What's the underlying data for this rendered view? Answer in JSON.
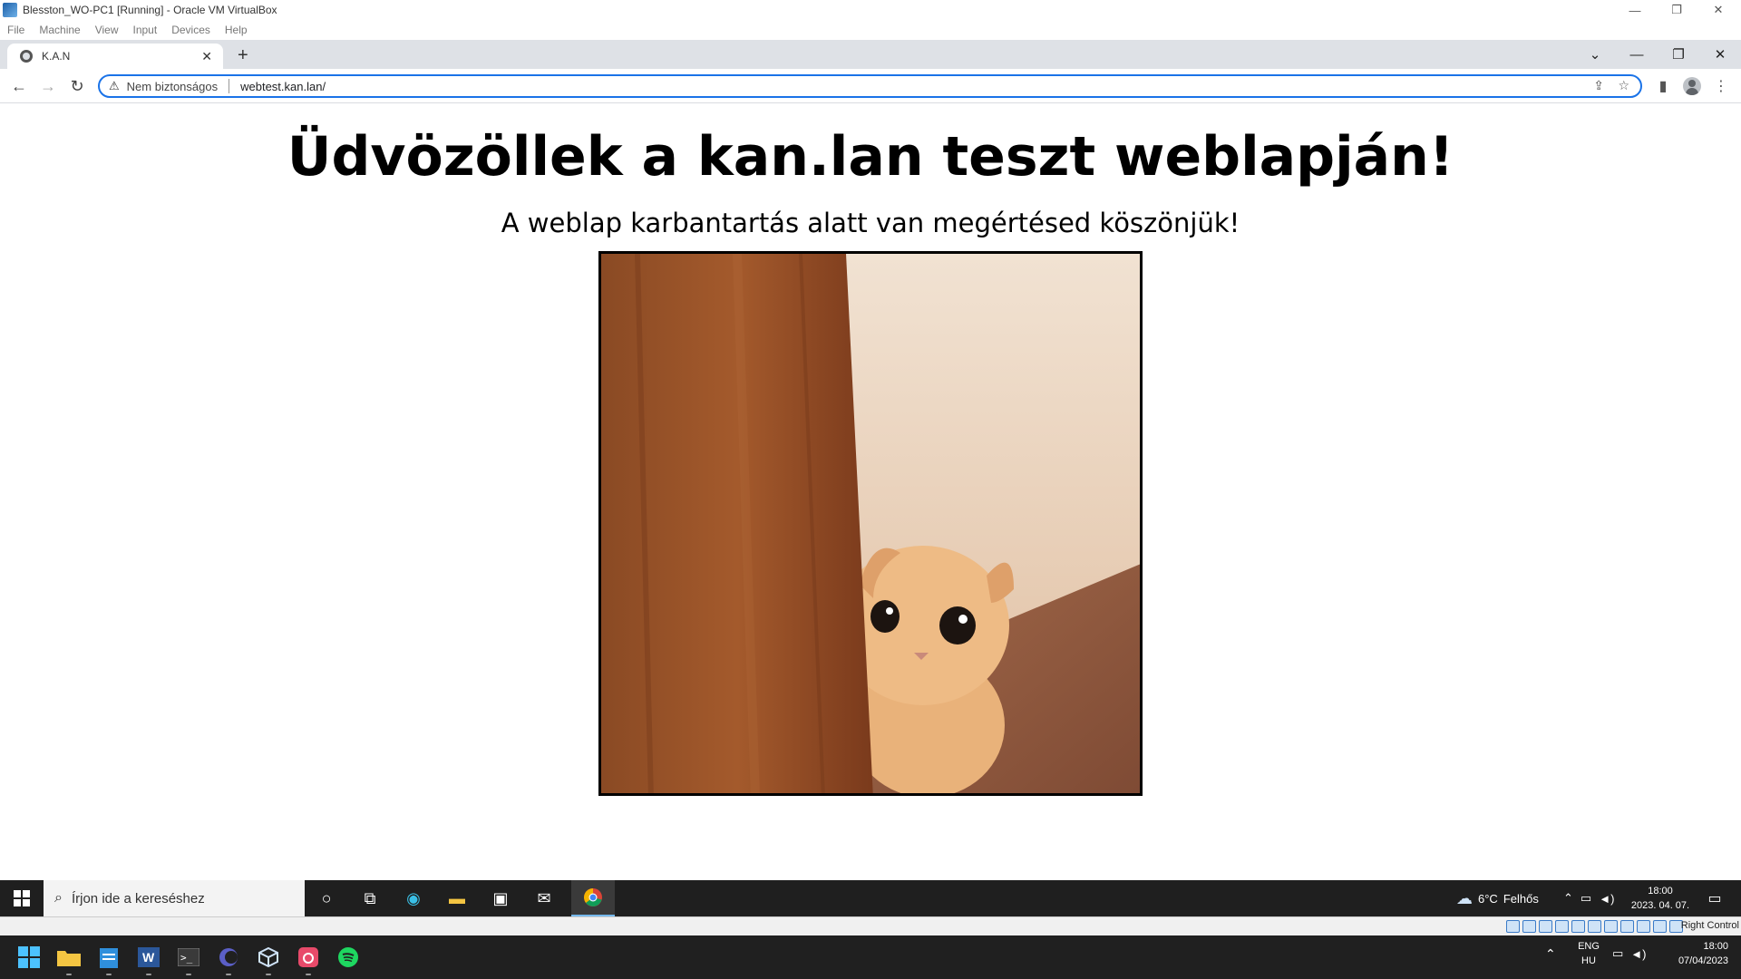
{
  "vbox": {
    "title": "Blesston_WO-PC1 [Running] - Oracle VM VirtualBox",
    "menu": [
      "File",
      "Machine",
      "View",
      "Input",
      "Devices",
      "Help"
    ],
    "right_control": "Right Control"
  },
  "browser": {
    "tab_title": "K.A.N",
    "security_label": "Nem biztonságos",
    "url": "webtest.kan.lan/"
  },
  "page": {
    "heading": "Üdvözöllek a kan.lan teszt weblapján!",
    "subheading": "A weblap karbantartás alatt van megértésed köszönjük!"
  },
  "guest_taskbar": {
    "search_placeholder": "Írjon ide a kereséshez",
    "weather_temp": "6°C",
    "weather_text": "Felhős",
    "time": "18:00",
    "date": "2023. 04. 07."
  },
  "host_taskbar": {
    "lang_top": "ENG",
    "lang_bottom": "HU",
    "time": "18:00",
    "date": "07/04/2023"
  }
}
